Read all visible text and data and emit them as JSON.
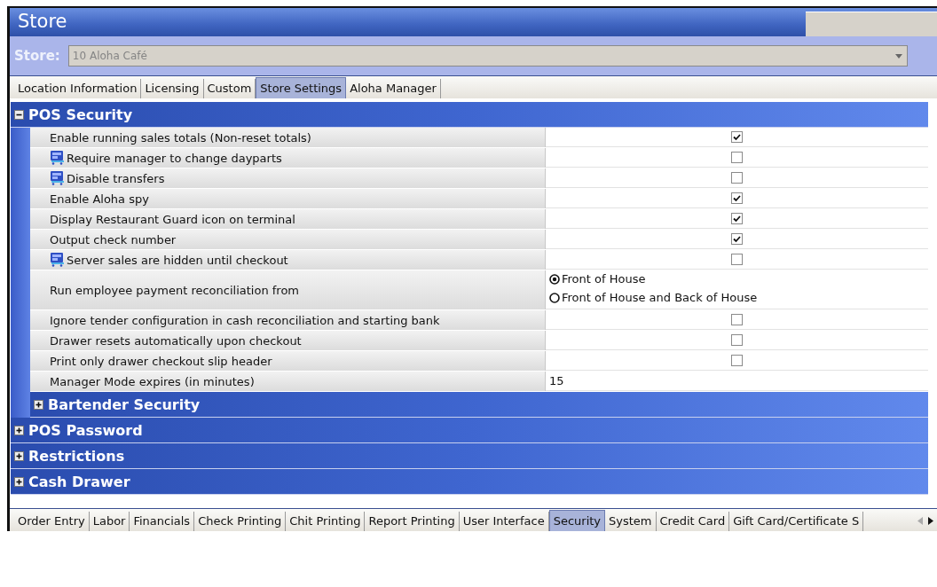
{
  "window": {
    "title": "Store"
  },
  "store_selector": {
    "label": "Store:",
    "value": "10 Aloha Café"
  },
  "top_tabs": [
    {
      "label": "Location Information",
      "selected": false
    },
    {
      "label": "Licensing",
      "selected": false
    },
    {
      "label": "Custom",
      "selected": false
    },
    {
      "label": "Store Settings",
      "selected": true
    },
    {
      "label": "Aloha Manager",
      "selected": false
    }
  ],
  "sections": [
    {
      "title": "POS Security",
      "expanded": true,
      "rows": [
        {
          "label": "Enable running sales totals (Non-reset totals)",
          "icon": false,
          "kind": "checkbox",
          "checked": true
        },
        {
          "label": "Require manager to change dayparts",
          "icon": true,
          "kind": "checkbox",
          "checked": false
        },
        {
          "label": "Disable transfers",
          "icon": true,
          "kind": "checkbox",
          "checked": false
        },
        {
          "label": "Enable Aloha spy",
          "icon": false,
          "kind": "checkbox",
          "checked": true
        },
        {
          "label": "Display Restaurant Guard icon on terminal",
          "icon": false,
          "kind": "checkbox",
          "checked": true
        },
        {
          "label": "Output check number",
          "icon": false,
          "kind": "checkbox",
          "checked": true
        },
        {
          "label": "Server sales are hidden until checkout",
          "icon": true,
          "kind": "checkbox",
          "checked": false
        },
        {
          "label": "Run employee payment reconciliation from",
          "icon": false,
          "kind": "radio",
          "options": [
            {
              "label": "Front of House",
              "selected": true
            },
            {
              "label": "Front of House and Back of House",
              "selected": false
            }
          ]
        },
        {
          "label": "Ignore tender configuration in cash reconciliation and starting bank",
          "icon": false,
          "kind": "checkbox",
          "checked": false
        },
        {
          "label": "Drawer resets automatically upon checkout",
          "icon": false,
          "kind": "checkbox",
          "checked": false
        },
        {
          "label": "Print only drawer checkout slip header",
          "icon": false,
          "kind": "checkbox",
          "checked": false
        },
        {
          "label": "Manager Mode expires (in minutes)",
          "icon": false,
          "kind": "text",
          "value": "15"
        }
      ],
      "children": [
        {
          "title": "Bartender Security",
          "expanded": false
        }
      ]
    },
    {
      "title": "POS Password",
      "expanded": false
    },
    {
      "title": "Restrictions",
      "expanded": false
    },
    {
      "title": "Cash Drawer",
      "expanded": false
    }
  ],
  "bottom_tabs": [
    {
      "label": "Order Entry",
      "selected": false
    },
    {
      "label": "Labor",
      "selected": false
    },
    {
      "label": "Financials",
      "selected": false
    },
    {
      "label": "Check Printing",
      "selected": false
    },
    {
      "label": "Chit Printing",
      "selected": false
    },
    {
      "label": "Report Printing",
      "selected": false
    },
    {
      "label": "User Interface",
      "selected": false
    },
    {
      "label": "Security",
      "selected": true
    },
    {
      "label": "System",
      "selected": false
    },
    {
      "label": "Credit Card",
      "selected": false
    },
    {
      "label": "Gift Card/Certificate S",
      "selected": false
    }
  ]
}
